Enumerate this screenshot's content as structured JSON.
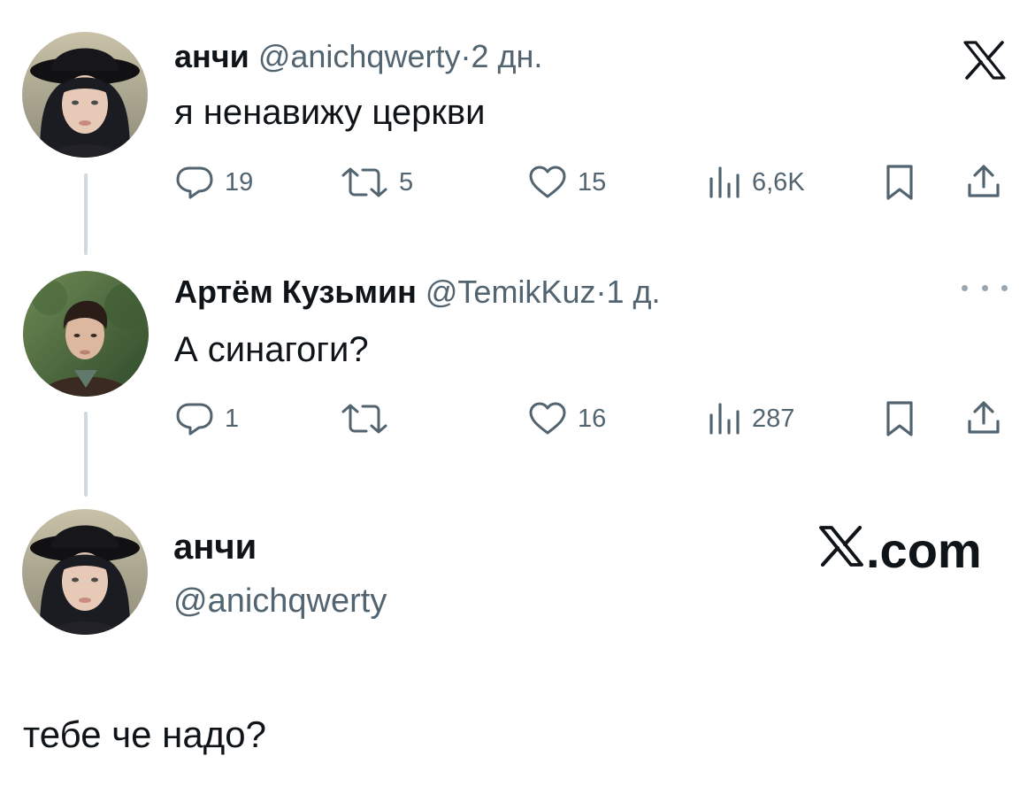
{
  "tweet1": {
    "name": "анчи",
    "handle": "@anichqwerty",
    "dot": "·",
    "time": "2 дн.",
    "text": "я ненавижу церкви",
    "replies": "19",
    "reposts": "5",
    "likes": "15",
    "views": "6,6K"
  },
  "tweet2": {
    "name": "Артём Кузьмин",
    "handle": "@TemikKuz",
    "dot": "·",
    "time": "1 д.",
    "text": "А синагоги?",
    "replies": "1",
    "reposts": "",
    "likes": "16",
    "views": "287"
  },
  "profile": {
    "name": "анчи",
    "handle": "@anichqwerty",
    "brand_text": ".com"
  },
  "reply": {
    "text": "тебе че надо?"
  },
  "colors": {
    "text": "#0f1419",
    "secondary": "#536471",
    "thread_line": "#cfd9de"
  },
  "icons": [
    "reply-icon",
    "repost-icon",
    "like-icon",
    "views-icon",
    "bookmark-icon",
    "share-icon",
    "x-logo-icon",
    "more-icon"
  ]
}
